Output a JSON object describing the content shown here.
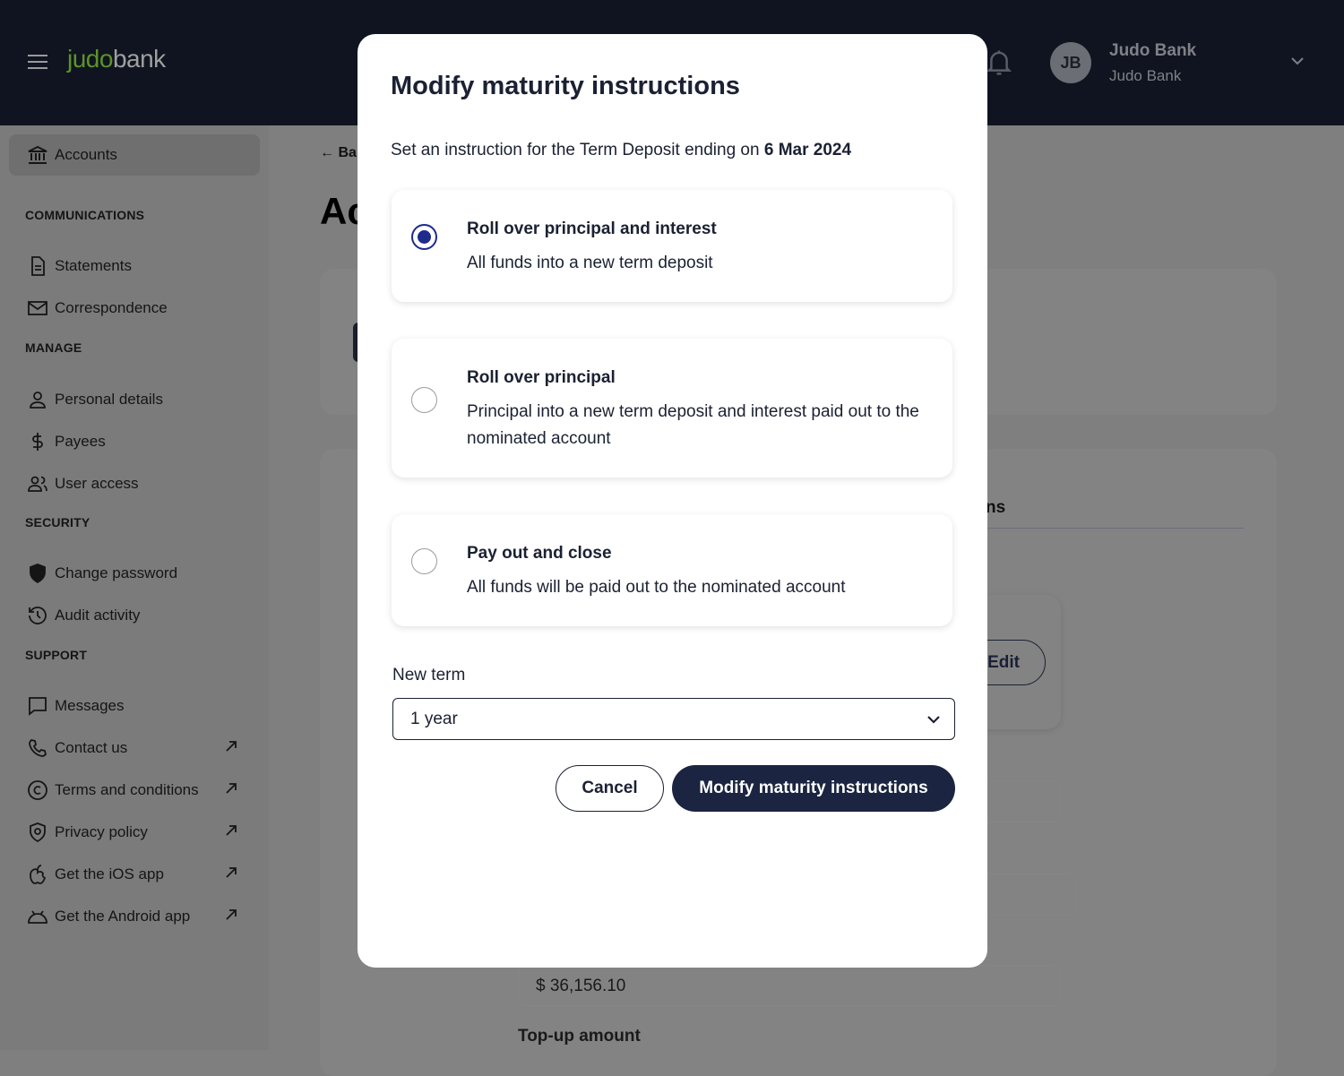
{
  "header": {
    "logo_a": "judo",
    "logo_b": "bank",
    "user_name": "Judo Bank",
    "user_org": "Judo Bank",
    "avatar_initials": "JB"
  },
  "sidebar": {
    "accounts": "Accounts",
    "sections": [
      {
        "title": "COMMUNICATIONS",
        "items": [
          "Statements",
          "Correspondence"
        ]
      },
      {
        "title": "MANAGE",
        "items": [
          "Personal details",
          "Payees",
          "User access"
        ]
      },
      {
        "title": "SECURITY",
        "items": [
          "Change password",
          "Audit activity"
        ]
      },
      {
        "title": "SUPPORT",
        "items": [
          "Messages",
          "Contact us",
          "Terms and conditions",
          "Privacy policy",
          "Get the iOS app",
          "Get the Android app"
        ]
      }
    ]
  },
  "background": {
    "back_label": "Ba",
    "page_title": "Ac",
    "tab_label": "ns",
    "edit_label": "Edit",
    "amount": "$ 36,156.10",
    "topup_label": "Top-up amount"
  },
  "modal": {
    "title": "Modify maturity instructions",
    "subtitle_prefix": "Set an instruction for the Term Deposit ending on ",
    "subtitle_date": "6 Mar 2024",
    "options": [
      {
        "title": "Roll over principal and interest",
        "desc": "All funds into a new term deposit",
        "selected": true
      },
      {
        "title": "Roll over principal",
        "desc": "Principal into a new term deposit and interest paid out to the nominated account",
        "selected": false
      },
      {
        "title": "Pay out and close",
        "desc": "All funds will be paid out to the nominated account",
        "selected": false
      }
    ],
    "new_term_label": "New term",
    "new_term_value": "1 year",
    "cancel_label": "Cancel",
    "submit_label": "Modify maturity instructions"
  },
  "colors": {
    "header_bg": "#0f1420",
    "accent": "#1d2b8a",
    "primary_button": "#1b2440",
    "logo_green": "#5d9327"
  }
}
